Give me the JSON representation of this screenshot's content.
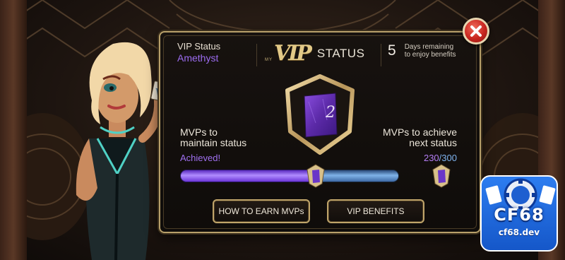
{
  "header": {
    "vip_status_label": "VIP Status",
    "vip_status_value": "Amethyst",
    "logo_my": "MY",
    "logo_vip": "VIP",
    "logo_status": "STATUS",
    "days_remaining": "5",
    "days_text_line1": "Days remaining",
    "days_text_line2": "to enjoy benefits"
  },
  "badge": {
    "level": "2"
  },
  "maintain": {
    "label_line1": "MVPs to",
    "label_line2": "maintain status",
    "state": "Achieved!"
  },
  "achieve": {
    "label_line1": "MVPs to achieve",
    "label_line2": "next status",
    "current": "230",
    "separator": "/",
    "max": "300"
  },
  "progress": {
    "maintain_fraction": 0.62,
    "achieve_fraction": 0.767
  },
  "buttons": {
    "how_to_earn": "HOW TO EARN MVPs",
    "vip_benefits": "VIP BENEFITS"
  },
  "watermark": {
    "brand": "CF68",
    "domain": "cf68.dev"
  },
  "colors": {
    "gold_border": "#b8a06a",
    "amethyst": "#9c6cf0",
    "progress_blue": "#7fb3e8",
    "close_red": "#c8261f",
    "watermark_blue": "#1557c9"
  },
  "icons": {
    "close": "close-x-icon",
    "level_badge": "shield-badge-icon",
    "gem": "amethyst-gem-icon"
  }
}
